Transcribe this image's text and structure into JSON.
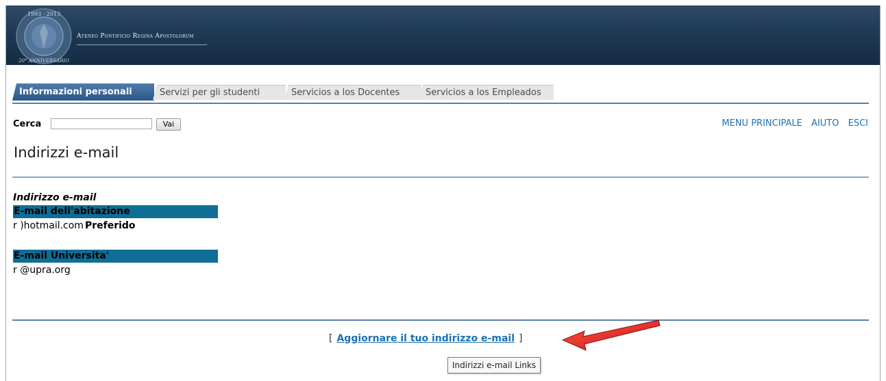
{
  "banner": {
    "institution": "Ateneo Pontificio Regina Apostolorum",
    "seal_years": "1993 · 2013",
    "seal_caption": "20° Anniversario"
  },
  "tabs": [
    {
      "label": "Informazioni personali",
      "active": true
    },
    {
      "label": "Servizi per gli studenti",
      "active": false
    },
    {
      "label": "Servicios a los Docentes",
      "active": false
    },
    {
      "label": "Servicios a los Empleados",
      "active": false
    }
  ],
  "search": {
    "label": "Cerca",
    "value": "",
    "button": "Vai"
  },
  "toplinks": {
    "main_menu": "MENU PRINCIPALE",
    "help": "AIUTO",
    "exit": "ESCI"
  },
  "page": {
    "title": "Indirizzi e-mail",
    "section_caption": "Indirizzo e-mail"
  },
  "emails": [
    {
      "type": "E-mail dell'abitazione",
      "address": "r           )hotmail.com",
      "badge": "Preferido"
    },
    {
      "type": "E-mail Universita'",
      "address": "r           @upra.org",
      "badge": ""
    }
  ],
  "footer": {
    "bracket_open": "[",
    "update_link": "Aggiornare il tuo indirizzo e-mail",
    "bracket_close": "]"
  },
  "tooltip": "Indirizzi e-mail Links",
  "colors": {
    "banner": "#1f3a55",
    "active_tab": "#3a6699",
    "section_header": "#0e6e96",
    "link": "#1b72b4",
    "annotation_arrow": "#e01010"
  }
}
